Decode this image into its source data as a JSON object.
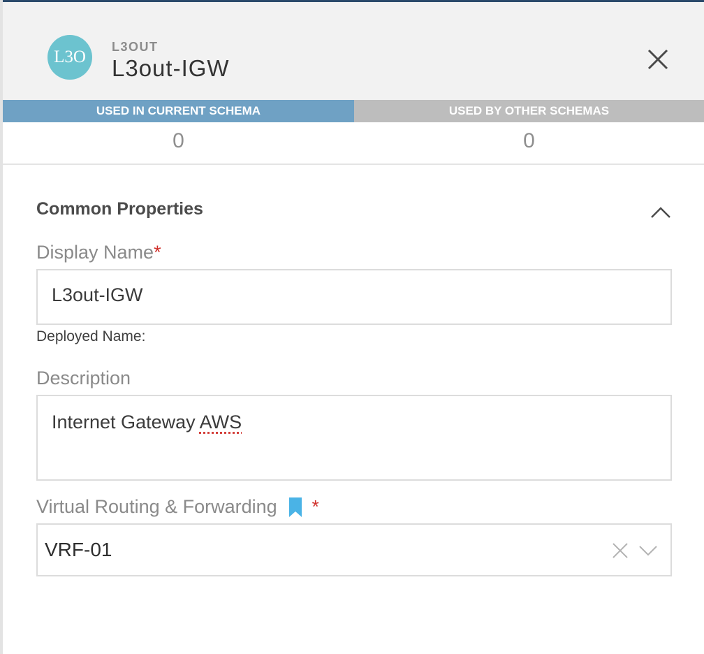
{
  "header": {
    "avatar_text": "L3O",
    "kind_label": "L3OUT",
    "title": "L3out-IGW"
  },
  "usage": {
    "current_label": "USED IN CURRENT SCHEMA",
    "current_count": "0",
    "other_label": "USED BY OTHER SCHEMAS",
    "other_count": "0"
  },
  "common_properties": {
    "title": "Common Properties",
    "display_name": {
      "label": "Display Name",
      "required_mark": "*",
      "value": "L3out-IGW",
      "deployed_name_label": "Deployed Name:"
    },
    "description": {
      "label": "Description",
      "value_prefix": "Internet Gateway ",
      "value_flagged": "AWS"
    },
    "vrf": {
      "label": "Virtual Routing & Forwarding",
      "required_mark": "*",
      "selected": "VRF-01"
    }
  },
  "colors": {
    "avatar_bg": "#6cc3cf",
    "usage_current_bg": "#6fa1c4",
    "usage_other_bg": "#bdbdbd",
    "required": "#d0302b",
    "bookmark": "#4ab3e6"
  },
  "icons": {
    "close": "close-icon",
    "collapse": "chevron-up-icon",
    "bookmark": "bookmark-icon",
    "clear": "clear-icon",
    "dropdown": "chevron-down-icon"
  }
}
